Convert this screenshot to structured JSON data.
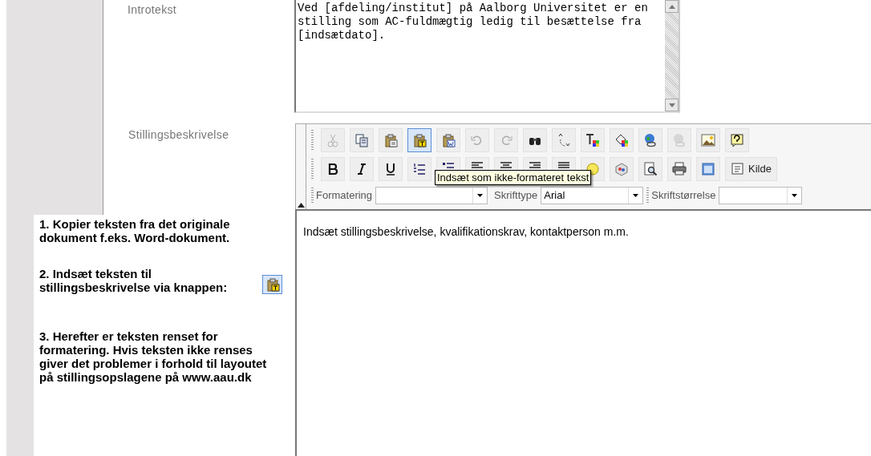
{
  "intro": {
    "label": "Introtekst",
    "text": "Ved [afdeling/institut] på Aalborg Universitet er en stilling som AC-fuldmægtig ledig til besættelse fra [indsætdato]."
  },
  "description": {
    "label": "Stillingsbeskrivelse"
  },
  "toolbar": {
    "rows": [
      [
        {
          "disabled": true,
          "selected": false
        },
        {
          "disabled": false,
          "selected": false
        },
        {
          "disabled": false,
          "selected": false
        },
        {
          "disabled": false,
          "selected": true
        },
        {
          "disabled": false,
          "selected": false
        },
        {
          "disabled": true,
          "selected": false
        },
        {
          "disabled": true,
          "selected": false
        },
        {
          "disabled": false,
          "selected": false
        },
        {
          "disabled": false,
          "selected": false
        },
        {
          "disabled": false,
          "selected": false
        },
        {
          "disabled": false,
          "selected": false
        },
        {
          "disabled": false,
          "selected": false
        },
        {
          "disabled": true,
          "selected": false
        },
        {
          "disabled": false,
          "selected": false
        },
        {
          "disabled": false,
          "selected": false
        }
      ],
      [
        {
          "disabled": false,
          "selected": false
        },
        {
          "disabled": false,
          "selected": false
        },
        {
          "disabled": false,
          "selected": false
        },
        {
          "disabled": false,
          "selected": false
        },
        {
          "disabled": false,
          "selected": false
        },
        {
          "disabled": false,
          "selected": false
        },
        {
          "disabled": false,
          "selected": false
        },
        {
          "disabled": false,
          "selected": false
        },
        {
          "disabled": false,
          "selected": false
        },
        {
          "disabled": false,
          "selected": false
        },
        {
          "disabled": false,
          "selected": false
        },
        {
          "disabled": false,
          "selected": false
        },
        {
          "disabled": false,
          "selected": false
        },
        {
          "disabled": false,
          "selected": false
        },
        {
          "disabled": false,
          "selected": false,
          "label": "Kilde"
        }
      ]
    ],
    "combos": [
      {
        "label": "Formatering"
      },
      {
        "label": "Skrifttype",
        "value": "Arial"
      },
      {
        "label": "Skriftstørrelse"
      }
    ]
  },
  "tooltip": "Indsæt som ikke-formateret tekst",
  "editor": {
    "text": "Indsæt stillingsbeskrivelse, kvalifikationskrav, kontaktperson m.m."
  },
  "instructions": [
    "1. Kopier teksten fra det originale dokument f.eks. Word-dokument.",
    "2. Indsæt teksten til stillingsbeskrivelse via knappen:",
    "3. Herefter er teksten renset for formatering. Hvis teksten ikke renses giver det problemer i forhold til layoutet på stillingsopslagene på www.aau.dk"
  ]
}
